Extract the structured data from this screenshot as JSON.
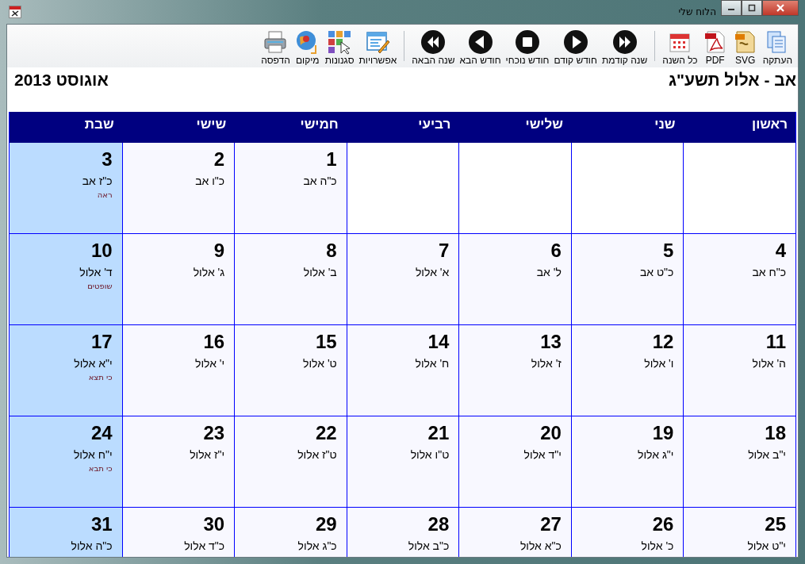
{
  "window": {
    "title": "הלוח שלי"
  },
  "toolbar": {
    "groups": [
      [
        {
          "label": "העתקה",
          "kind": "copy"
        },
        {
          "label": "SVG",
          "kind": "svg"
        },
        {
          "label": "PDF",
          "kind": "pdf"
        },
        {
          "label": "כל השנה",
          "kind": "calendar"
        }
      ],
      [
        {
          "label": "שנה קודמת",
          "kind": "fastforward"
        },
        {
          "label": "חודש קודם",
          "kind": "play"
        },
        {
          "label": "חודש נוכחי",
          "kind": "stop"
        },
        {
          "label": "חודש הבא",
          "kind": "back"
        },
        {
          "label": "שנה הבאה",
          "kind": "rewind"
        }
      ],
      [
        {
          "label": "אפשרויות",
          "kind": "options"
        },
        {
          "label": "סגנונות",
          "kind": "styles"
        },
        {
          "label": "מיקום",
          "kind": "location"
        },
        {
          "label": "הדפסה",
          "kind": "print"
        }
      ]
    ]
  },
  "header": {
    "hebrew_month": "אב - אלול תשע\"ג",
    "gregorian_month": "אוגוסט 2013"
  },
  "weekdays": [
    "ראשון",
    "שני",
    "שלישי",
    "רביעי",
    "חמישי",
    "שישי",
    "שבת"
  ],
  "weeks": [
    [
      {
        "kind": "empty"
      },
      {
        "kind": "empty"
      },
      {
        "kind": "empty"
      },
      {
        "kind": "empty"
      },
      {
        "kind": "day",
        "day": "1",
        "hebrew": "כ\"ה אב"
      },
      {
        "kind": "day",
        "day": "2",
        "hebrew": "כ\"ו אב"
      },
      {
        "kind": "shabbat",
        "day": "3",
        "hebrew": "כ\"ז אב",
        "parasha": "ראה"
      }
    ],
    [
      {
        "kind": "day",
        "day": "4",
        "hebrew": "כ\"ח אב"
      },
      {
        "kind": "day",
        "day": "5",
        "hebrew": "כ\"ט אב"
      },
      {
        "kind": "day",
        "day": "6",
        "hebrew": "ל' אב"
      },
      {
        "kind": "day",
        "day": "7",
        "hebrew": "א' אלול"
      },
      {
        "kind": "day",
        "day": "8",
        "hebrew": "ב' אלול"
      },
      {
        "kind": "day",
        "day": "9",
        "hebrew": "ג' אלול"
      },
      {
        "kind": "shabbat",
        "day": "10",
        "hebrew": "ד' אלול",
        "parasha": "שופטים"
      }
    ],
    [
      {
        "kind": "day",
        "day": "11",
        "hebrew": "ה' אלול"
      },
      {
        "kind": "day",
        "day": "12",
        "hebrew": "ו' אלול"
      },
      {
        "kind": "day",
        "day": "13",
        "hebrew": "ז' אלול"
      },
      {
        "kind": "day",
        "day": "14",
        "hebrew": "ח' אלול"
      },
      {
        "kind": "day",
        "day": "15",
        "hebrew": "ט' אלול"
      },
      {
        "kind": "day",
        "day": "16",
        "hebrew": "י' אלול"
      },
      {
        "kind": "shabbat",
        "day": "17",
        "hebrew": "י\"א אלול",
        "parasha": "כי תצא"
      }
    ],
    [
      {
        "kind": "day",
        "day": "18",
        "hebrew": "י\"ב אלול"
      },
      {
        "kind": "day",
        "day": "19",
        "hebrew": "י\"ג אלול"
      },
      {
        "kind": "day",
        "day": "20",
        "hebrew": "י\"ד אלול"
      },
      {
        "kind": "day",
        "day": "21",
        "hebrew": "ט\"ו אלול"
      },
      {
        "kind": "day",
        "day": "22",
        "hebrew": "ט\"ז אלול"
      },
      {
        "kind": "day",
        "day": "23",
        "hebrew": "י\"ז אלול"
      },
      {
        "kind": "shabbat",
        "day": "24",
        "hebrew": "י\"ח אלול",
        "parasha": "כי תבא"
      }
    ],
    [
      {
        "kind": "day",
        "day": "25",
        "hebrew": "י\"ט אלול"
      },
      {
        "kind": "day",
        "day": "26",
        "hebrew": "כ' אלול"
      },
      {
        "kind": "day",
        "day": "27",
        "hebrew": "כ\"א אלול"
      },
      {
        "kind": "day",
        "day": "28",
        "hebrew": "כ\"ב אלול"
      },
      {
        "kind": "day",
        "day": "29",
        "hebrew": "כ\"ג אלול"
      },
      {
        "kind": "day",
        "day": "30",
        "hebrew": "כ\"ד אלול"
      },
      {
        "kind": "shabbat",
        "day": "31",
        "hebrew": "כ\"ה אלול"
      }
    ]
  ]
}
